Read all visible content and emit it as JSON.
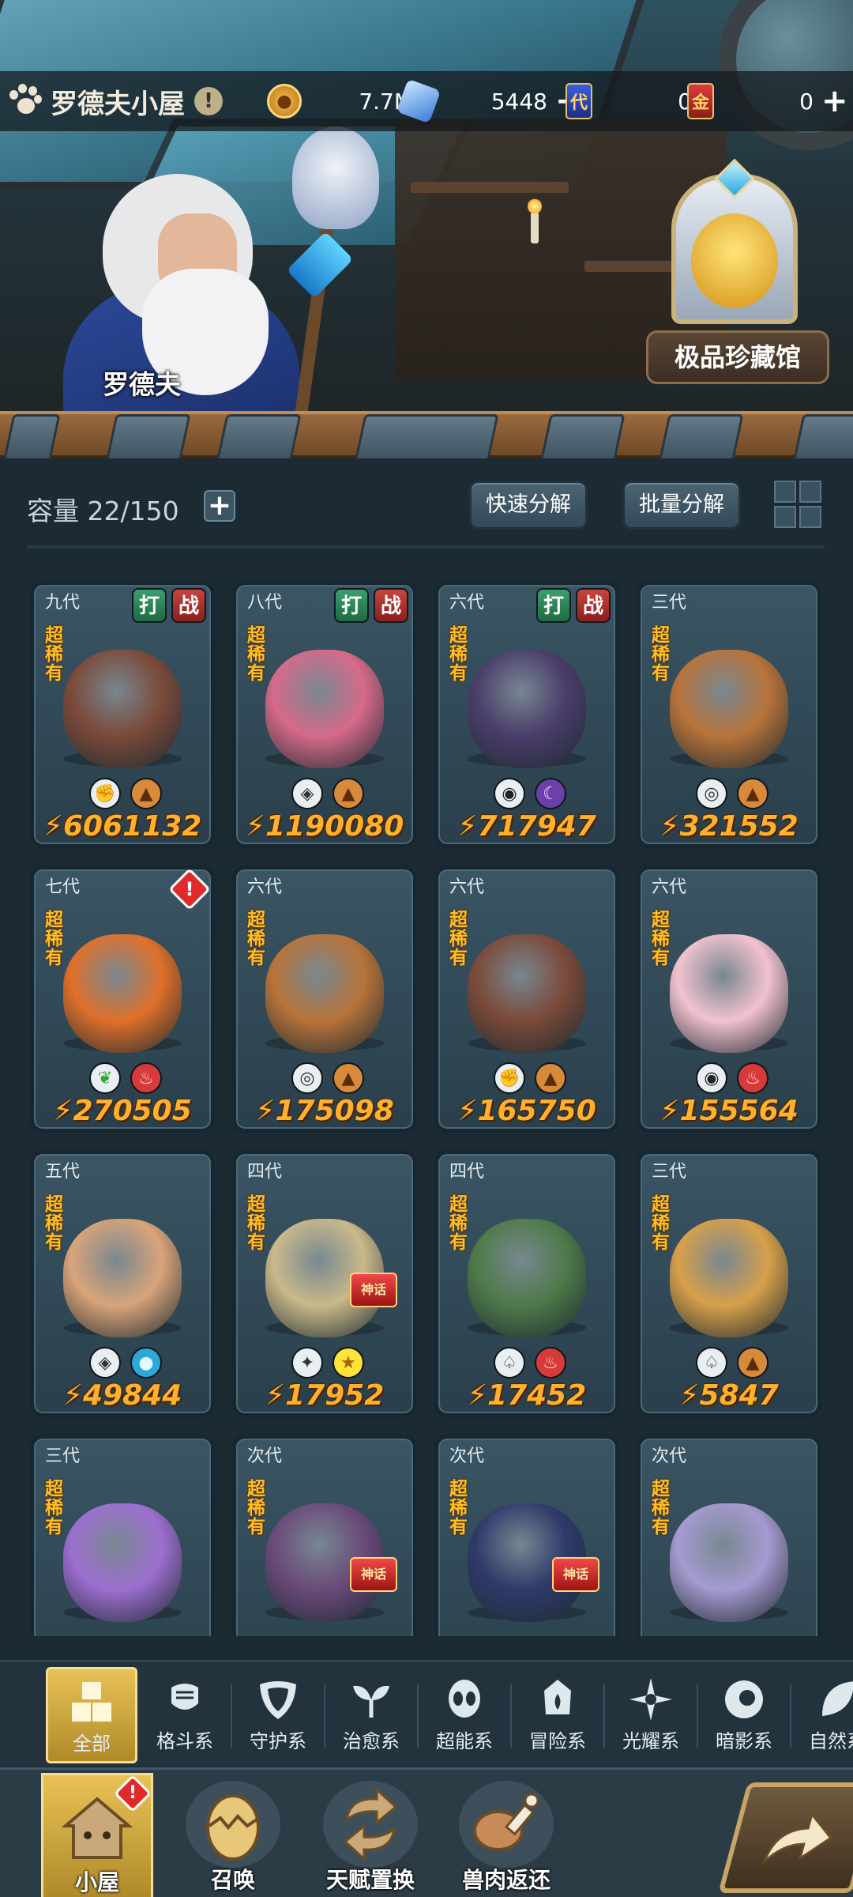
{
  "header": {
    "title": "罗德夫小屋",
    "info_mark": "!",
    "resources": [
      {
        "name": "gold",
        "value": "7.7M",
        "icon": "gold-coin-icon"
      },
      {
        "name": "crystal",
        "value": "5448",
        "icon": "crystal-icon",
        "has_plus": true
      },
      {
        "name": "ticket-blue",
        "value": "0",
        "icon": "blue-ticket-icon",
        "glyph": "代"
      },
      {
        "name": "ticket-red",
        "value": "0",
        "icon": "red-ticket-icon",
        "glyph": "金",
        "has_plus": true
      }
    ],
    "plus_glyph": "+"
  },
  "scene": {
    "npc_name": "罗德夫",
    "museum_label": "极品珍藏馆"
  },
  "panel": {
    "capacity_label": "容量 22/150",
    "capacity_plus": "+",
    "quick_decompose": "快速分解",
    "batch_decompose": "批量分解"
  },
  "cards": [
    {
      "gen": "九代",
      "rarity": "超稀有",
      "power": "6061132",
      "badges": [
        "打",
        "战"
      ],
      "elements": [
        "fighting-icon",
        "earth-icon"
      ],
      "color": "#7b4a3a"
    },
    {
      "gen": "八代",
      "rarity": "超稀有",
      "power": "1190080",
      "badges": [
        "打",
        "战"
      ],
      "elements": [
        "guardian-icon",
        "earth-icon"
      ],
      "color": "#d66a8a"
    },
    {
      "gen": "六代",
      "rarity": "超稀有",
      "power": "717947",
      "badges": [
        "打",
        "战"
      ],
      "elements": [
        "shadow-icon",
        "dark-moon-icon"
      ],
      "color": "#4a3d6a"
    },
    {
      "gen": "三代",
      "rarity": "超稀有",
      "power": "321552",
      "badges": [],
      "elements": [
        "psychic-icon",
        "earth-icon"
      ],
      "color": "#b8743a"
    },
    {
      "gen": "七代",
      "rarity": "超稀有",
      "power": "270505",
      "badges": [],
      "alert": "!",
      "elements": [
        "healing-icon",
        "fire-icon"
      ],
      "color": "#e0702a"
    },
    {
      "gen": "六代",
      "rarity": "超稀有",
      "power": "175098",
      "badges": [],
      "elements": [
        "psychic-icon",
        "earth-icon"
      ],
      "color": "#b8743a"
    },
    {
      "gen": "六代",
      "rarity": "超稀有",
      "power": "165750",
      "badges": [],
      "elements": [
        "fighting-icon",
        "earth-icon"
      ],
      "color": "#7b4a3a"
    },
    {
      "gen": "六代",
      "rarity": "超稀有",
      "power": "155564",
      "badges": [],
      "elements": [
        "shadow-icon",
        "fire-icon"
      ],
      "color": "#f2c2cf"
    },
    {
      "gen": "五代",
      "rarity": "超稀有",
      "power": "49844",
      "badges": [],
      "elements": [
        "guardian-icon",
        "water-icon"
      ],
      "color": "#d9a47a"
    },
    {
      "gen": "四代",
      "rarity": "超稀有",
      "power": "17952",
      "badges": [],
      "mythic": true,
      "elements": [
        "light-icon",
        "star-icon"
      ],
      "color": "#c9b98a"
    },
    {
      "gen": "四代",
      "rarity": "超稀有",
      "power": "17452",
      "badges": [],
      "elements": [
        "adventure-icon",
        "fire-icon"
      ],
      "color": "#4f7a4a"
    },
    {
      "gen": "三代",
      "rarity": "超稀有",
      "power": "5847",
      "badges": [],
      "elements": [
        "adventure-icon",
        "earth-icon"
      ],
      "color": "#d8a04a"
    },
    {
      "gen": "三代",
      "rarity": "超稀有",
      "power": "",
      "badges": [],
      "elements": [],
      "color": "#9d6fd0"
    },
    {
      "gen": "次代",
      "rarity": "超稀有",
      "power": "",
      "badges": [],
      "mythic": true,
      "elements": [],
      "color": "#6a4a7a"
    },
    {
      "gen": "次代",
      "rarity": "超稀有",
      "power": "",
      "badges": [],
      "mythic": true,
      "elements": [],
      "color": "#2f3a6a"
    },
    {
      "gen": "次代",
      "rarity": "超稀有",
      "power": "",
      "badges": [],
      "elements": [],
      "color": "#a69ad0"
    }
  ],
  "mythic_label": "神话",
  "category_tabs": [
    {
      "label": "全部",
      "icon": "all-blocks-icon",
      "active": true
    },
    {
      "label": "格斗系",
      "icon": "fist-icon"
    },
    {
      "label": "守护系",
      "icon": "shield-icon"
    },
    {
      "label": "治愈系",
      "icon": "sprout-icon"
    },
    {
      "label": "超能系",
      "icon": "alien-icon"
    },
    {
      "label": "冒险系",
      "icon": "lantern-icon"
    },
    {
      "label": "光耀系",
      "icon": "sparkle-icon"
    },
    {
      "label": "暗影系",
      "icon": "eye-icon"
    },
    {
      "label": "自然系",
      "icon": "leaf-icon"
    }
  ],
  "bottom_nav": [
    {
      "label": "小屋",
      "icon": "house-icon",
      "active": true,
      "alert": "!"
    },
    {
      "label": "召唤",
      "icon": "egg-icon"
    },
    {
      "label": "天赋置换",
      "icon": "swap-icon"
    },
    {
      "label": "兽肉返还",
      "icon": "meat-icon"
    }
  ],
  "colors": {
    "accent_gold": "#e8c255",
    "power_orange": "#ffb12e",
    "rarity_yellow": "#ffbf23",
    "panel_bg": "#1b2a33"
  }
}
